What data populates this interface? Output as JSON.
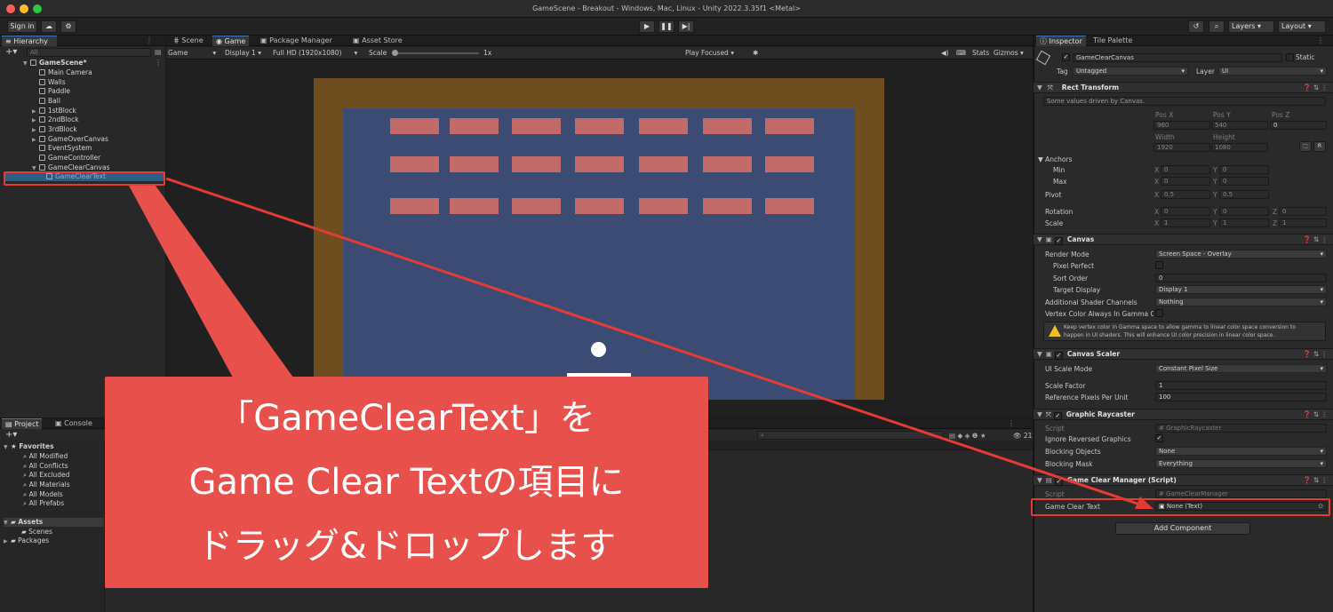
{
  "window": {
    "title": "GameScene - Breakout - Windows, Mac, Linux - Unity 2022.3.35f1 <Metal>"
  },
  "toolbar": {
    "sign_in": "Sign in",
    "layers": "Layers",
    "layout": "Layout"
  },
  "hierarchy": {
    "tab": "Hierarchy",
    "search_placeholder": "All",
    "scene": "GameScene*",
    "items": [
      {
        "label": "Main Camera"
      },
      {
        "label": "Walls"
      },
      {
        "label": "Paddle"
      },
      {
        "label": "Ball"
      },
      {
        "label": "1stBlock"
      },
      {
        "label": "2ndBlock"
      },
      {
        "label": "3rdBlock"
      },
      {
        "label": "GameOverCanvas"
      },
      {
        "label": "EventSystem"
      },
      {
        "label": "GameController"
      },
      {
        "label": "GameClearCanvas"
      },
      {
        "label": "GameClearText"
      }
    ]
  },
  "center_tabs": {
    "scene": "Scene",
    "game": "Game",
    "package_manager": "Package Manager",
    "asset_store": "Asset Store"
  },
  "game_toolbar": {
    "view": "Game",
    "display": "Display 1",
    "resolution": "Full HD (1920x1080)",
    "scale_label": "Scale",
    "scale_value": "1x",
    "play_mode": "Play Focused",
    "stats": "Stats",
    "gizmos": "Gizmos"
  },
  "project": {
    "tabs": {
      "project": "Project",
      "console": "Console"
    },
    "favorites": "Favorites",
    "favorite_items": [
      "All Modified",
      "All Conflicts",
      "All Excluded",
      "All Materials",
      "All Models",
      "All Prefabs"
    ],
    "assets": "Assets",
    "asset_items": [
      "Scenes"
    ],
    "packages": "Packages",
    "count": "21"
  },
  "inspector": {
    "tabs": {
      "inspector": "Inspector",
      "tile_palette": "Tile Palette"
    },
    "object_name": "GameClearCanvas",
    "static_label": "Static",
    "tag_label": "Tag",
    "tag_value": "Untagged",
    "layer_label": "Layer",
    "layer_value": "UI",
    "rect_transform": {
      "title": "Rect Transform",
      "note": "Some values driven by Canvas.",
      "pos_x_label": "Pos X",
      "pos_y_label": "Pos Y",
      "pos_z_label": "Pos Z",
      "pos_x": "960",
      "pos_y": "540",
      "pos_z": "0",
      "width_label": "Width",
      "height_label": "Height",
      "width": "1920",
      "height": "1080",
      "anchors": "Anchors",
      "min": "Min",
      "max": "Max",
      "pivot": "Pivot",
      "rotation": "Rotation",
      "scale": "Scale",
      "min_x": "0",
      "min_y": "0",
      "max_x": "0",
      "max_y": "0",
      "pivot_x": "0.5",
      "pivot_y": "0.5",
      "rot_x": "0",
      "rot_y": "0",
      "rot_z": "0",
      "scale_x": "1",
      "scale_y": "1",
      "scale_z": "1"
    },
    "canvas": {
      "title": "Canvas",
      "render_mode_label": "Render Mode",
      "render_mode": "Screen Space - Overlay",
      "pixel_perfect": "Pixel Perfect",
      "sort_order_label": "Sort Order",
      "sort_order": "0",
      "target_display_label": "Target Display",
      "target_display": "Display 1",
      "shader_channels_label": "Additional Shader Channels",
      "shader_channels": "Nothing",
      "vertex_color": "Vertex Color Always In Gamma C",
      "warning_line1": "Keep vertex color in Gamma space to allow gamma to linear color space conversion to",
      "warning_line2": "happen in UI shaders. This will enhance UI color precision in linear color space."
    },
    "canvas_scaler": {
      "title": "Canvas Scaler",
      "ui_scale_mode_label": "UI Scale Mode",
      "ui_scale_mode": "Constant Pixel Size",
      "scale_factor_label": "Scale Factor",
      "scale_factor": "1",
      "ref_ppu_label": "Reference Pixels Per Unit",
      "ref_ppu": "100"
    },
    "graphic_raycaster": {
      "title": "Graphic Raycaster",
      "script_label": "Script",
      "script_value": "GraphicRaycaster",
      "ignore_reversed": "Ignore Reversed Graphics",
      "blocking_objects_label": "Blocking Objects",
      "blocking_objects": "None",
      "blocking_mask_label": "Blocking Mask",
      "blocking_mask": "Everything"
    },
    "game_clear_manager": {
      "title": "Game Clear Manager (Script)",
      "script_label": "Script",
      "script_value": "GameClearManager",
      "game_clear_text_label": "Game Clear Text",
      "game_clear_text_value": "None (Text)"
    },
    "add_component": "Add Component"
  },
  "callout": {
    "line1": "「GameClearText」を",
    "line2": "Game Clear Textの項目に",
    "line3": "ドラッグ&ドロップします"
  },
  "colors": {
    "callout": "#e8514b",
    "highlight": "#e53b32",
    "game_border": "#6e4d1e",
    "game_field": "#3c4b74",
    "brick": "#c26a68"
  }
}
